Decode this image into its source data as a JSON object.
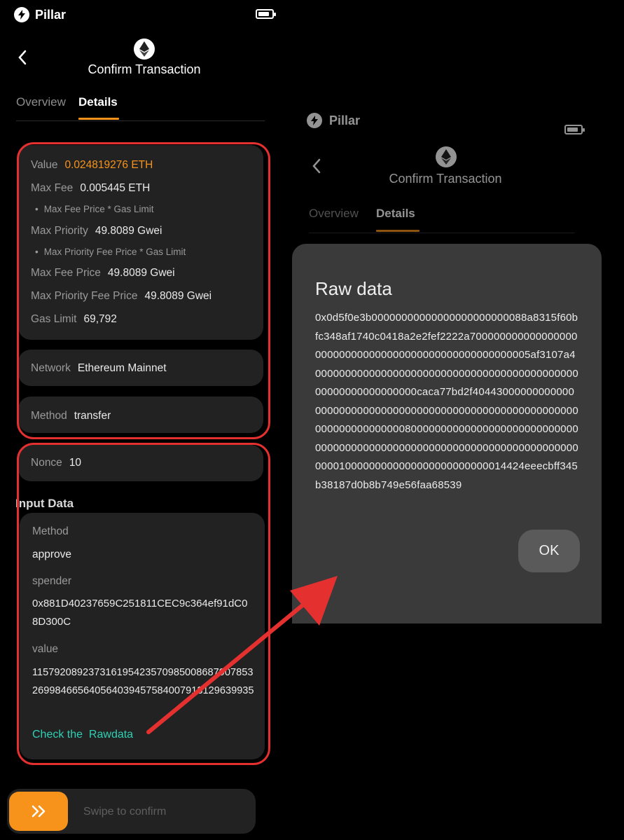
{
  "left": {
    "app_name": "Pillar",
    "title": "Confirm Transaction",
    "tabs": [
      {
        "label": "Overview"
      },
      {
        "label": "Details"
      }
    ],
    "value_label": "Value",
    "value": "0.024819276 ETH",
    "max_fee_label": "Max Fee",
    "max_fee": "0.005445 ETH",
    "max_fee_note": "Max Fee Price * Gas Limit",
    "max_priority_label": "Max Priority",
    "max_priority": "49.8089 Gwei",
    "max_priority_note": "Max Priority Fee Price * Gas Limit",
    "max_fee_price_label": "Max Fee Price",
    "max_fee_price": "49.8089 Gwei",
    "max_priority_fee_price_label": "Max Priority Fee Price",
    "max_priority_fee_price": "49.8089 Gwei",
    "gas_limit_label": "Gas Limit",
    "gas_limit": "69,792",
    "network_label": "Network",
    "network": "Ethereum Mainnet",
    "method_label": "Method",
    "method": "transfer",
    "nonce_label": "Nonce",
    "nonce": "10",
    "input_data_title": "Input Data",
    "input": {
      "method_label": "Method",
      "method": "approve",
      "spender_label": "spender",
      "spender": "0x881D40237659C251811CEC9c364ef91dC08D300C",
      "value_label": "value",
      "value": "115792089237316195423570985008687907853269984665640564039457584007913129639935",
      "check_rawdata": "Check the  Rawdata"
    },
    "swipe_label": "Swipe to confirm"
  },
  "right": {
    "app_name": "Pillar",
    "title": "Confirm Transaction",
    "tabs": [
      {
        "label": "Overview"
      },
      {
        "label": "Details"
      }
    ],
    "dialog": {
      "title": "Raw data",
      "raw": "0x0d5f0e3b00000000000000000000000088a8315f60bfc348af1740c0418a2e2fef2222a700000000000000000000000000000000000000000000000000005af3107a40000000000000000000000000000000000000000000000000000000000000caca77bd2f4044300000000000000000000000000000000000000000000000000000000000000000000000800000000000000000000000000000000000000000000000000000000000000000000000000001000000000000000000000000014424eeecbff345b38187d0b8b749e56faa68539",
      "ok_label": "OK"
    }
  },
  "colors": {
    "accent": "#f7931a",
    "annotation_red": "#e53030",
    "link": "#2fd1b4"
  }
}
